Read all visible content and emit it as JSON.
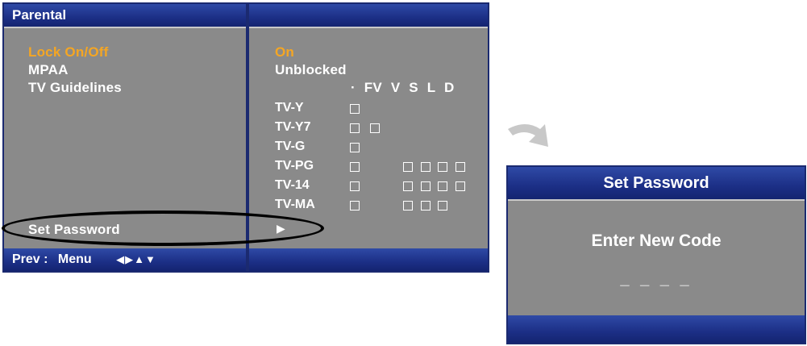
{
  "parental": {
    "title": "Parental",
    "menu": [
      {
        "label": "Lock On/Off",
        "selected": true
      },
      {
        "label": "MPAA",
        "selected": false
      },
      {
        "label": "TV Guidelines",
        "selected": false
      },
      {
        "label": "Set Password",
        "selected": false
      }
    ],
    "values": {
      "lock": "On",
      "mpaa": "Unblocked",
      "set_password_arrow": "▶"
    },
    "tv_guidelines": {
      "columns_header": "· FV V S L D",
      "ratings": [
        {
          "label": "TV-Y"
        },
        {
          "label": "TV-Y7"
        },
        {
          "label": "TV-G"
        },
        {
          "label": "TV-PG"
        },
        {
          "label": "TV-14"
        },
        {
          "label": "TV-MA"
        }
      ]
    },
    "footer": {
      "prev_label": "Prev :",
      "menu_label": "Menu",
      "nav_arrows": "◀▶▲▼"
    },
    "colors": {
      "selected": "#f5a623",
      "bar": "#1c2f86",
      "panel": "#8a8a8a"
    }
  },
  "set_password": {
    "title": "Set Password",
    "prompt": "Enter New Code",
    "code": "_ _ _ _"
  }
}
